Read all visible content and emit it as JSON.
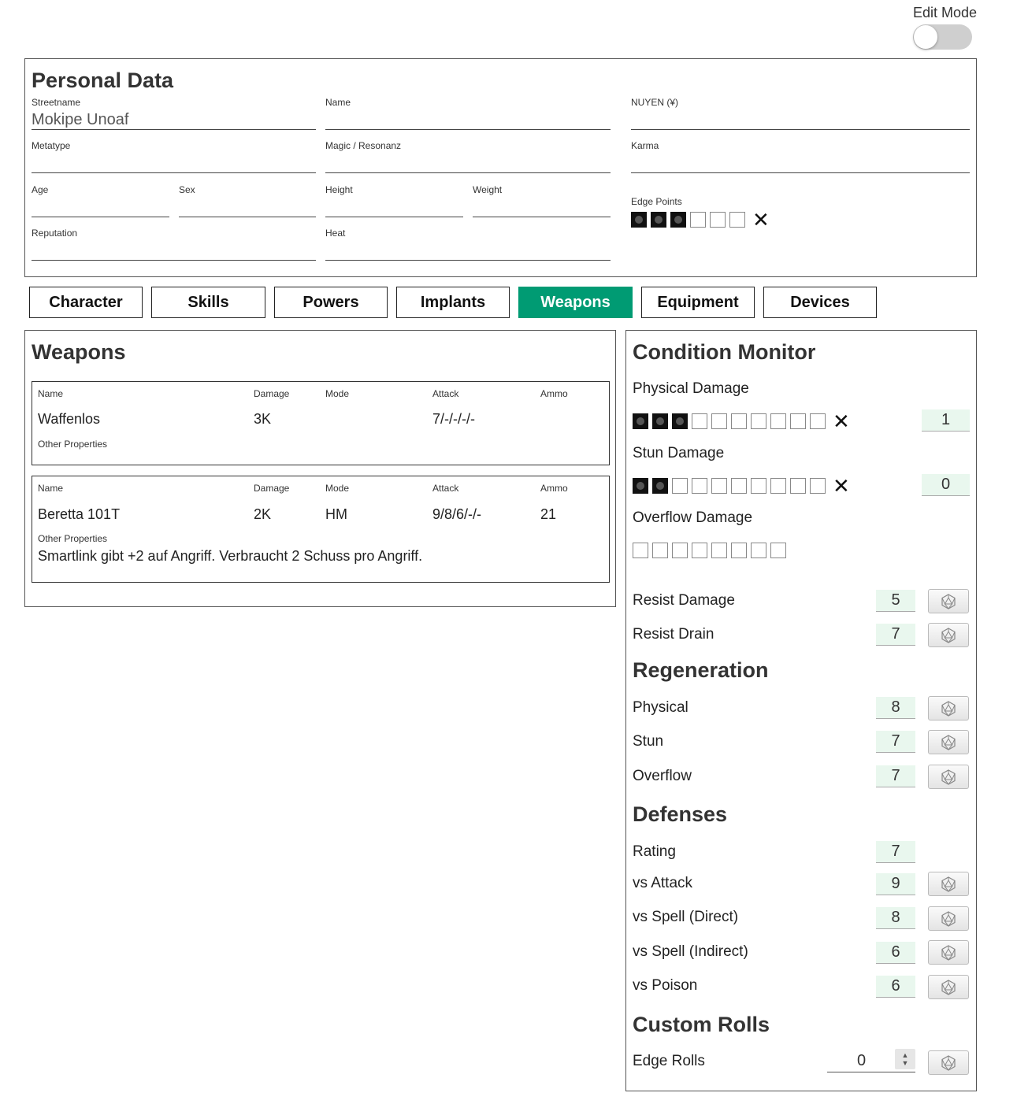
{
  "edit_mode": {
    "label": "Edit Mode",
    "enabled": false
  },
  "personal": {
    "title": "Personal Data",
    "streetname": {
      "label": "Streetname",
      "value": "Mokipe Unoaf"
    },
    "name": {
      "label": "Name",
      "value": ""
    },
    "nuyen": {
      "label": "NUYEN (¥)",
      "value": ""
    },
    "metatype": {
      "label": "Metatype",
      "value": ""
    },
    "magic": {
      "label": "Magic / Resonanz",
      "value": ""
    },
    "karma": {
      "label": "Karma",
      "value": ""
    },
    "age": {
      "label": "Age",
      "value": ""
    },
    "sex": {
      "label": "Sex",
      "value": ""
    },
    "height": {
      "label": "Height",
      "value": ""
    },
    "weight": {
      "label": "Weight",
      "value": ""
    },
    "reputation": {
      "label": "Reputation",
      "value": ""
    },
    "heat": {
      "label": "Heat",
      "value": ""
    },
    "edge": {
      "label": "Edge Points",
      "filled": 3,
      "total": 6
    }
  },
  "tabs": [
    {
      "label": "Character",
      "active": false
    },
    {
      "label": "Skills",
      "active": false
    },
    {
      "label": "Powers",
      "active": false
    },
    {
      "label": "Implants",
      "active": false
    },
    {
      "label": "Weapons",
      "active": true
    },
    {
      "label": "Equipment",
      "active": false
    },
    {
      "label": "Devices",
      "active": false
    }
  ],
  "weapons": {
    "title": "Weapons",
    "headers": {
      "name": "Name",
      "damage": "Damage",
      "mode": "Mode",
      "attack": "Attack",
      "ammo": "Ammo",
      "other": "Other Properties"
    },
    "items": [
      {
        "name": "Waffenlos",
        "damage": "3K",
        "mode": "",
        "attack": "7/-/-/-/-",
        "ammo": "",
        "other": ""
      },
      {
        "name": "Beretta 101T",
        "damage": "2K",
        "mode": "HM",
        "attack": "9/8/6/-/-",
        "ammo": "21",
        "other": "Smartlink gibt +2 auf Angriff. Verbraucht 2 Schuss pro Angriff."
      }
    ]
  },
  "condition": {
    "title": "Condition Monitor",
    "physical": {
      "label": "Physical Damage",
      "filled": 3,
      "total": 10,
      "value": "1"
    },
    "stun": {
      "label": "Stun Damage",
      "filled": 2,
      "total": 10,
      "value": "0"
    },
    "overflow": {
      "label": "Overflow Damage",
      "filled": 0,
      "total": 8
    },
    "resist_damage": {
      "label": "Resist Damage",
      "value": "5"
    },
    "resist_drain": {
      "label": "Resist Drain",
      "value": "7"
    }
  },
  "regeneration": {
    "title": "Regeneration",
    "physical": {
      "label": "Physical",
      "value": "8"
    },
    "stun": {
      "label": "Stun",
      "value": "7"
    },
    "overflow": {
      "label": "Overflow",
      "value": "7"
    }
  },
  "defenses": {
    "title": "Defenses",
    "rating": {
      "label": "Rating",
      "value": "7"
    },
    "vs_attack": {
      "label": "vs Attack",
      "value": "9"
    },
    "vs_spell_direct": {
      "label": "vs Spell (Direct)",
      "value": "8"
    },
    "vs_spell_indirect": {
      "label": "vs Spell (Indirect)",
      "value": "6"
    },
    "vs_poison": {
      "label": "vs Poison",
      "value": "6"
    }
  },
  "custom_rolls": {
    "title": "Custom Rolls",
    "edge_rolls": {
      "label": "Edge Rolls",
      "value": "0"
    }
  },
  "icons": {
    "dice": "d20-dice-icon",
    "clear": "clear-x-icon"
  },
  "colors": {
    "accent": "#009b73",
    "value_bg": "#e9f7ee"
  }
}
